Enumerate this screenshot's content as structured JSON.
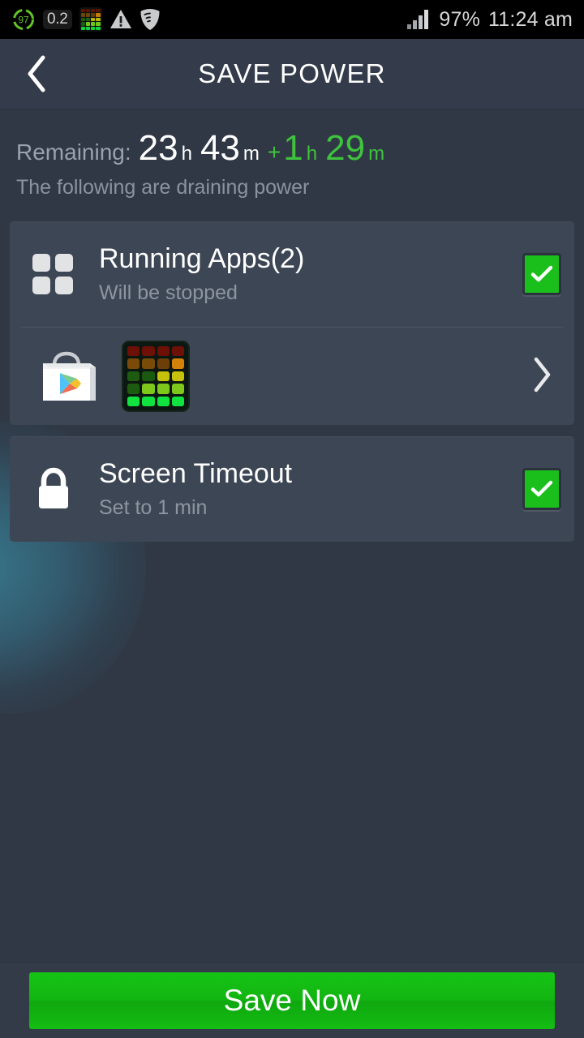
{
  "statusbar": {
    "battery_ring_value": "97",
    "load_badge": "0.2",
    "grid_icon": "cpu-grid-icon",
    "warning_icon": "warning-triangle-icon",
    "shield_icon": "shield-icon",
    "signal_icon": "signal-bars-icon",
    "battery_percent": "97%",
    "clock": "11:24 am",
    "grid_colors": [
      "#5c1205",
      "#5c1205",
      "#5c1205",
      "#5c1205",
      "#6b4408",
      "#6b4408",
      "#5e3c07",
      "#c87a06",
      "#1d5c12",
      "#1d5c12",
      "#b9b60a",
      "#b9b60a",
      "#1d5c12",
      "#72c31a",
      "#72c31a",
      "#72c31a",
      "#0fd63c",
      "#0fd63c",
      "#0fd63c",
      "#0fd63c"
    ]
  },
  "header": {
    "back_icon": "back-chevron-icon",
    "title": "SAVE POWER"
  },
  "summary": {
    "label": "Remaining:",
    "hours": "23",
    "hours_unit": "h",
    "minutes": "43",
    "minutes_unit": "m",
    "plus": "+",
    "gain_hours": "1",
    "gain_hours_unit": "h",
    "gain_minutes": "29",
    "gain_minutes_unit": "m",
    "note": "The following are draining power",
    "accent_color": "#3fc33f"
  },
  "cards": {
    "running_apps": {
      "icon": "apps-grid-icon",
      "title": "Running Apps(2)",
      "subtitle": "Will be stopped",
      "checkbox_icon": "checkmark-icon",
      "checked": true,
      "apps": [
        {
          "name": "play-store-icon"
        },
        {
          "name": "cpu-monitor-icon"
        }
      ],
      "chevron_icon": "chevron-right-icon",
      "cpu_icon_colors": [
        "#6d1006",
        "#6d1006",
        "#6d1006",
        "#6d1006",
        "#7a4a08",
        "#7a4a08",
        "#6b3f07",
        "#d4820a",
        "#1d5c10",
        "#1a5a0e",
        "#c6c20b",
        "#c6c20b",
        "#1d5c10",
        "#7ec81c",
        "#7ec81c",
        "#7ec81c",
        "#11e23f",
        "#11e23f",
        "#11e23f",
        "#11e23f"
      ]
    },
    "screen_timeout": {
      "icon": "lock-icon",
      "title": "Screen Timeout",
      "subtitle": "Set to 1 min",
      "checkbox_icon": "checkmark-icon",
      "checked": true
    }
  },
  "footer": {
    "save_label": "Save Now",
    "button_color": "#12b511"
  }
}
